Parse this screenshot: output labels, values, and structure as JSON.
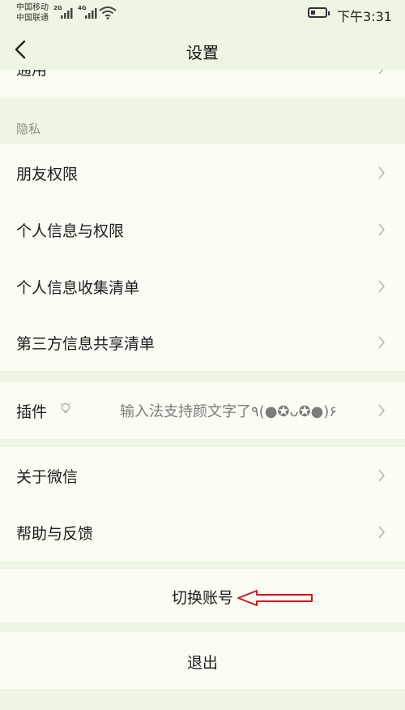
{
  "status_bar": {
    "carrier_1": "中国移动",
    "carrier_2": "中国联通",
    "net_1": "2G",
    "net_2": "4G",
    "time": "下午3:31"
  },
  "header": {
    "title": "设置"
  },
  "general": {
    "label": "通用"
  },
  "privacy": {
    "section_label": "隐私",
    "items": [
      {
        "label": "朋友权限"
      },
      {
        "label": "个人信息与权限"
      },
      {
        "label": "个人信息收集清单"
      },
      {
        "label": "第三方信息共享清单"
      }
    ]
  },
  "plugins": {
    "label": "插件",
    "note": "输入法支持颜文字了٩(●✪ᴗ✪●)۶"
  },
  "about": {
    "label": "关于微信"
  },
  "help": {
    "label": "帮助与反馈"
  },
  "switch_account": {
    "label": "切换账号"
  },
  "logout": {
    "label": "退出"
  },
  "colors": {
    "background": "#eef5e4",
    "card": "#fbfdf3",
    "annotation_arrow": "#d0161c"
  }
}
